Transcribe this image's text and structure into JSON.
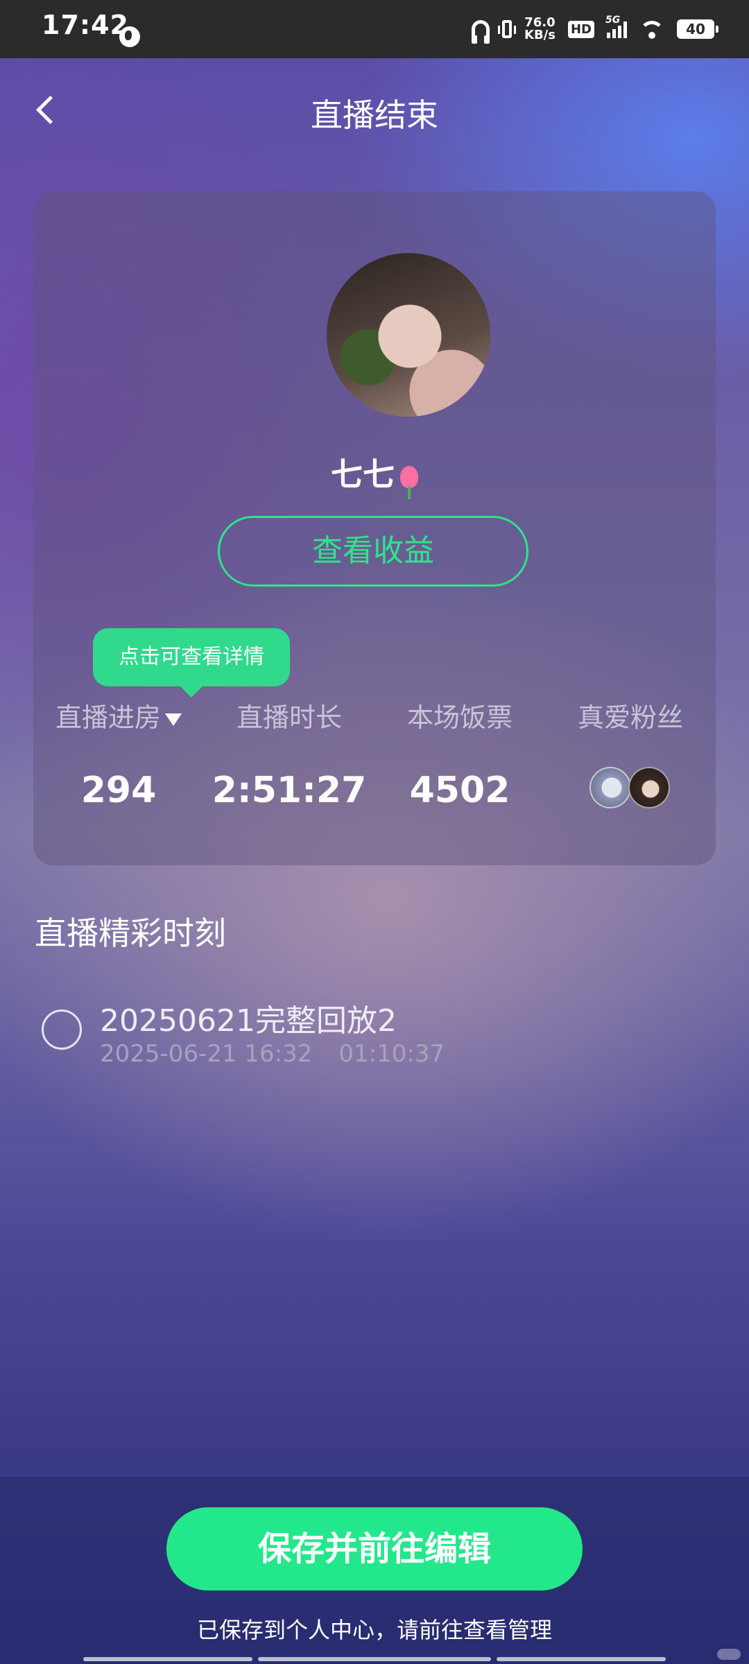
{
  "status_bar": {
    "time": "17:42",
    "net_speed_value": "76.0",
    "net_speed_unit": "KB/s",
    "hd": "HD",
    "network_type": "5G",
    "battery": "40"
  },
  "header": {
    "title": "直播结束"
  },
  "card": {
    "username": "七七",
    "earnings_button": "查看收益",
    "tooltip": "点击可查看详情",
    "stats": [
      {
        "label": "直播进房",
        "value": "294"
      },
      {
        "label": "直播时长",
        "value": "2:51:27"
      },
      {
        "label": "本场饭票",
        "value": "4502"
      },
      {
        "label": "真爱粉丝"
      }
    ]
  },
  "highlights": {
    "section_title": "直播精彩时刻",
    "items": [
      {
        "title": "20250621完整回放2",
        "datetime": "2025-06-21 16:32",
        "duration": "01:10:37"
      }
    ]
  },
  "footer": {
    "save_button": "保存并前往编辑",
    "note": "已保存到个人中心，请前往查看管理"
  },
  "colors": {
    "accent_green": "#23e88b",
    "status_bar_bg": "#2b2b2b"
  },
  "icons": [
    "back-arrow-icon",
    "headphone-icon",
    "vibrate-icon",
    "wifi-icon",
    "battery-icon",
    "dropdown-arrow-icon",
    "tulip-emoji-icon",
    "radio-icon"
  ]
}
